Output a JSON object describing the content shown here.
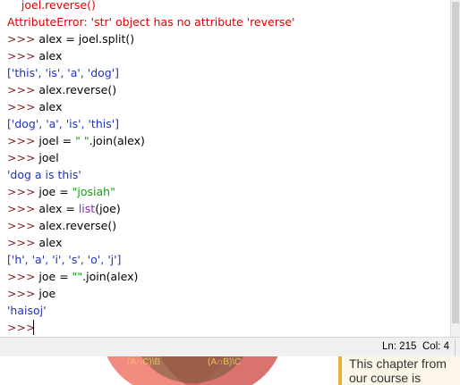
{
  "shell": {
    "lines": [
      {
        "kind": "input",
        "prompt": "",
        "text": "    joel.reverse()",
        "style": "err"
      },
      {
        "kind": "error",
        "text": "AttributeError: 'str' object has no attribute 'reverse'"
      },
      {
        "kind": "input",
        "prompt": ">>>",
        "text": "alex = joel.split()"
      },
      {
        "kind": "input",
        "prompt": ">>>",
        "text": "alex"
      },
      {
        "kind": "output",
        "text": "['this', 'is', 'a', 'dog']"
      },
      {
        "kind": "input",
        "prompt": ">>>",
        "text": "alex.reverse()"
      },
      {
        "kind": "input",
        "prompt": ">>>",
        "text": "alex"
      },
      {
        "kind": "output",
        "text": "['dog', 'a', 'is', 'this']"
      },
      {
        "kind": "input",
        "prompt": ">>>",
        "pre": "joel = ",
        "string": "\" \"",
        "post": ".join(alex)"
      },
      {
        "kind": "input",
        "prompt": ">>>",
        "text": "joel"
      },
      {
        "kind": "output",
        "text": "'dog a is this'"
      },
      {
        "kind": "input",
        "prompt": ">>>",
        "pre": "joe = ",
        "string": "\"josiah\"",
        "post": ""
      },
      {
        "kind": "input",
        "prompt": ">>>",
        "pre": "alex = ",
        "builtin": "list",
        "post": "(joe)"
      },
      {
        "kind": "input",
        "prompt": ">>>",
        "text": "alex.reverse()"
      },
      {
        "kind": "input",
        "prompt": ">>>",
        "text": "alex"
      },
      {
        "kind": "output",
        "text": "['h', 'a', 'i', 's', 'o', 'j']"
      },
      {
        "kind": "input",
        "prompt": ">>>",
        "pre": "joe = ",
        "string": "\"\"",
        "post": ".join(alex)"
      },
      {
        "kind": "input",
        "prompt": ">>>",
        "text": "joe"
      },
      {
        "kind": "output",
        "text": "'haisoj'"
      },
      {
        "kind": "input",
        "prompt": ">>>",
        "text": ""
      }
    ]
  },
  "status": {
    "ln": "Ln: 215",
    "col": "Col: 4"
  },
  "background_page": {
    "venn_labels": [
      "(A∩C)\\B",
      "(A∩B)\\C"
    ],
    "side_text_line1": "This chapter from",
    "side_text_line2": "our course is"
  }
}
